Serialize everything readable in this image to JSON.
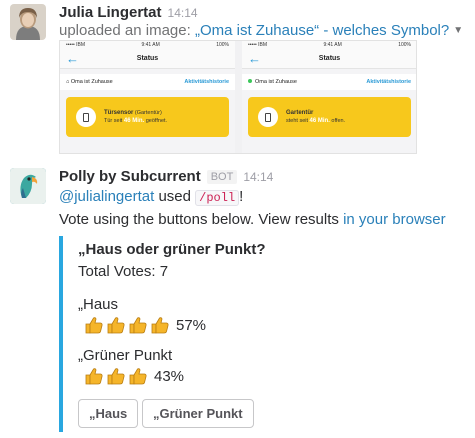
{
  "message1": {
    "author": "Julia Lingertat",
    "time": "14:14",
    "upload_prefix": "uploaded an image:",
    "upload_title": "„Oma ist Zuhause“ - welches Symbol?",
    "screens": [
      {
        "carrier": "••••• IBM",
        "clock": "9:41 AM",
        "battery": "100%",
        "nav_title": "Status",
        "home_label": "Oma ist Zuhause",
        "history_link": "Aktivitätshistorie",
        "home_dot": false,
        "card_title": "Türsensor",
        "card_title_suffix": "(Gartentür)",
        "card_status_pre": "Tür seit",
        "card_status_value": "46 Min.",
        "card_status_post": "geöffnet."
      },
      {
        "carrier": "••••• IBM",
        "clock": "9:41 AM",
        "battery": "100%",
        "nav_title": "Status",
        "home_label": "Oma ist Zuhause",
        "history_link": "Aktivitätshistorie",
        "home_dot": true,
        "card_title": "Gartentür",
        "card_title_suffix": "",
        "card_status_pre": "steht seit",
        "card_status_value": "46 Min.",
        "card_status_post": "offen."
      }
    ]
  },
  "message2": {
    "author": "Polly by Subcurrent",
    "bot_tag": "BOT",
    "time": "14:14",
    "mention": "@julialingertat",
    "used_word": "used",
    "command": "/poll",
    "exclaim": "!",
    "vote_text": "Vote using the buttons below. View results",
    "results_link": "in your browser",
    "poll": {
      "title": "„Haus oder grüner Punkt?",
      "total_votes": "Total Votes: 7",
      "options": [
        {
          "label": "„Haus",
          "thumbs": 4,
          "percent": "57%"
        },
        {
          "label": "„Grüner Punkt",
          "thumbs": 3,
          "percent": "43%"
        }
      ],
      "buttons": [
        "„Haus",
        "„Grüner Punkt"
      ]
    }
  },
  "colors": {
    "link": "#2a80b9",
    "accent_bar": "#29a7e0",
    "card_yellow": "#f7c81c",
    "thumb_yellow": "#f5b52a"
  }
}
